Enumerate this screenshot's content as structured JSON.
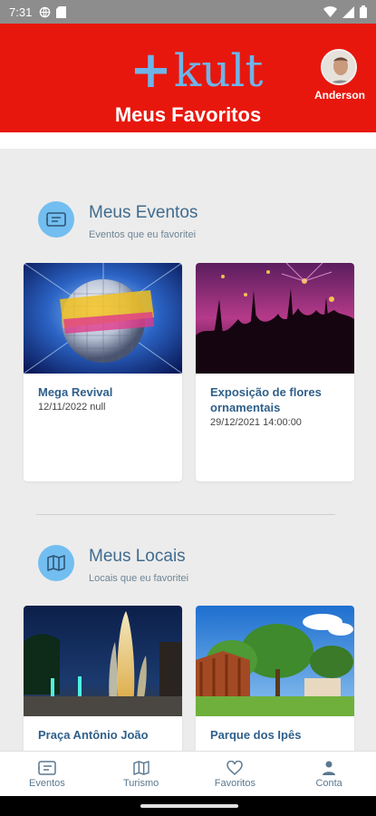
{
  "status": {
    "time": "7:31"
  },
  "header": {
    "logo_plus": "+",
    "logo_word": "kult",
    "title": "Meus Favoritos",
    "user_name": "Anderson"
  },
  "eventos": {
    "title": "Meus Eventos",
    "subtitle": "Eventos que eu favoritei",
    "cards": [
      {
        "title": "Mega Revival",
        "subtitle": "12/11/2022 null"
      },
      {
        "title": "Exposição de flores ornamentais",
        "subtitle": "29/12/2021 14:00:00"
      }
    ]
  },
  "locais": {
    "title": "Meus Locais",
    "subtitle": "Locais que eu favoritei",
    "cards": [
      {
        "title": "Praça Antônio João",
        "subtitle": ""
      },
      {
        "title": "Parque dos Ipês",
        "subtitle": ""
      }
    ]
  },
  "nav": [
    {
      "label": "Eventos",
      "icon": "ticket-icon"
    },
    {
      "label": "Turismo",
      "icon": "map-icon"
    },
    {
      "label": "Favoritos",
      "icon": "heart-icon"
    },
    {
      "label": "Conta",
      "icon": "person-icon"
    }
  ],
  "colors": {
    "header_red": "#e8170d",
    "accent_blue": "#72bef0",
    "title_blue": "#3f6b8f"
  }
}
